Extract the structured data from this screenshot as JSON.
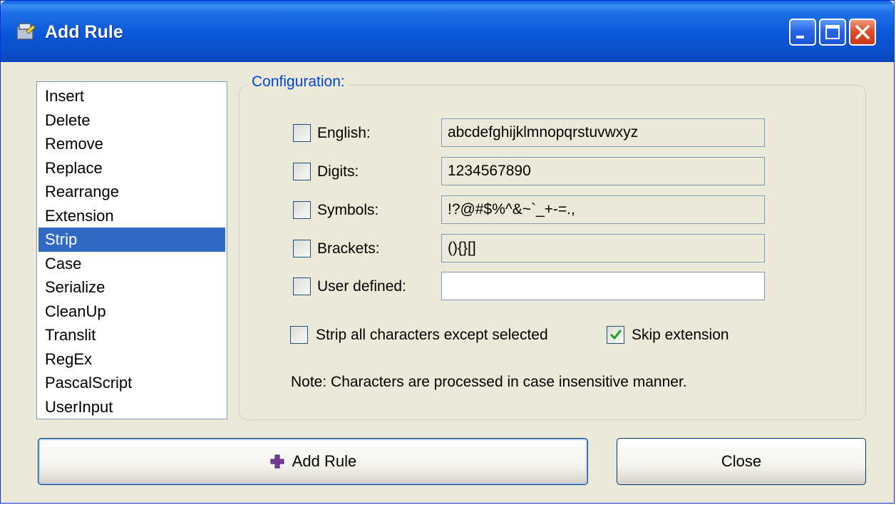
{
  "window": {
    "title": "Add Rule"
  },
  "rules": [
    {
      "label": "Insert",
      "selected": false
    },
    {
      "label": "Delete",
      "selected": false
    },
    {
      "label": "Remove",
      "selected": false
    },
    {
      "label": "Replace",
      "selected": false
    },
    {
      "label": "Rearrange",
      "selected": false
    },
    {
      "label": "Extension",
      "selected": false
    },
    {
      "label": "Strip",
      "selected": true
    },
    {
      "label": "Case",
      "selected": false
    },
    {
      "label": "Serialize",
      "selected": false
    },
    {
      "label": "CleanUp",
      "selected": false
    },
    {
      "label": "Translit",
      "selected": false
    },
    {
      "label": "RegEx",
      "selected": false
    },
    {
      "label": "PascalScript",
      "selected": false
    },
    {
      "label": "UserInput",
      "selected": false
    }
  ],
  "config": {
    "legend": "Configuration:",
    "options": [
      {
        "label": "English:",
        "value": "abcdefghijklmnopqrstuvwxyz",
        "checked": false
      },
      {
        "label": "Digits:",
        "value": "1234567890",
        "checked": false
      },
      {
        "label": "Symbols:",
        "value": "!?@#$%^&~`_+-=.,",
        "checked": false
      },
      {
        "label": "Brackets:",
        "value": "(){}[]",
        "checked": false
      },
      {
        "label": "User defined:",
        "value": "",
        "checked": false
      }
    ],
    "strip_all_label": "Strip all characters except selected",
    "strip_all_checked": false,
    "skip_extension_label": "Skip extension",
    "skip_extension_checked": true,
    "note": "Note: Characters are processed in case insensitive manner."
  },
  "buttons": {
    "add_rule": "Add Rule",
    "close": "Close"
  },
  "colors": {
    "title_bar": "#0a57d8",
    "selection": "#316ac5",
    "legend": "#0046d5",
    "close_button": "#e0502b"
  }
}
